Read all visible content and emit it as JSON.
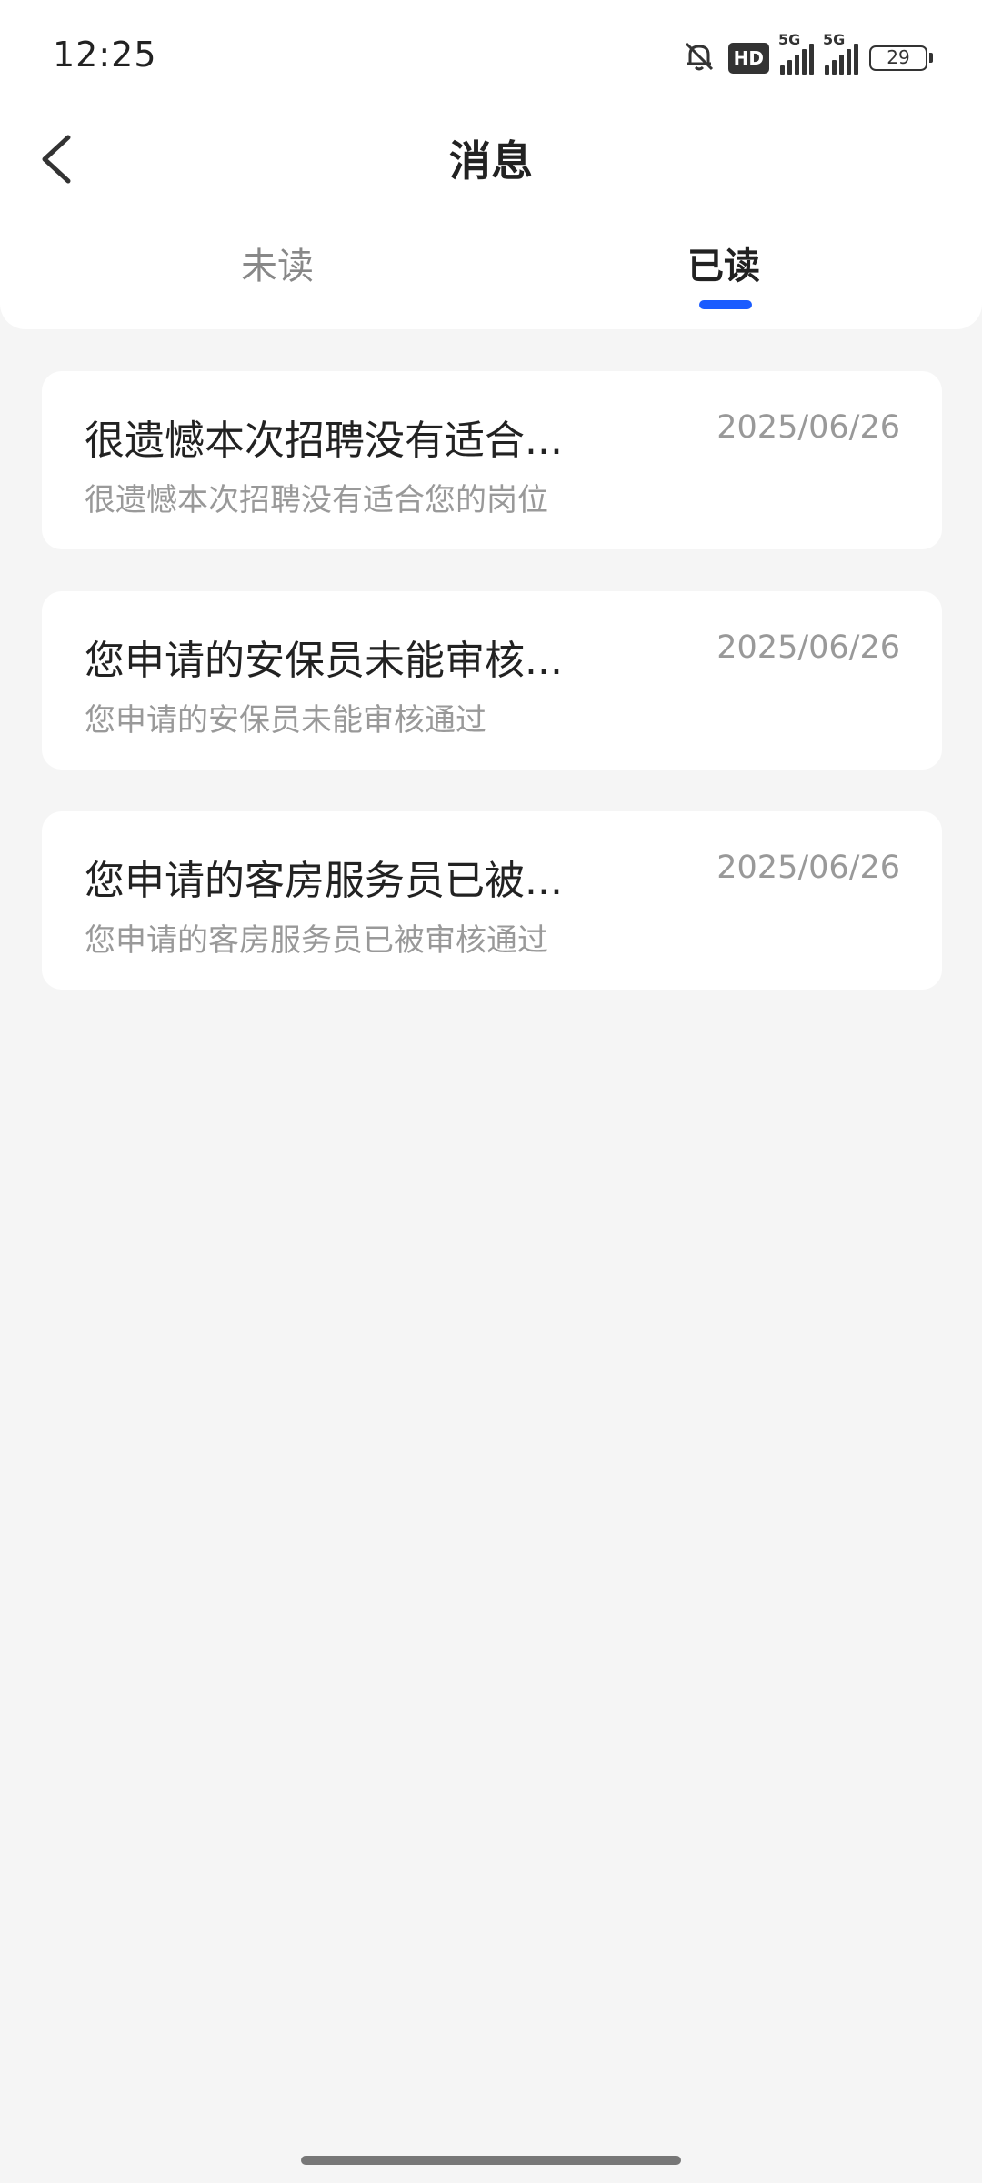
{
  "status_bar": {
    "time": "12:25",
    "icons": [
      "bell-off-icon",
      "hd-voice-icon",
      "signal-5g-icon",
      "signal-5g-icon",
      "battery-icon"
    ],
    "hd_label": "HD",
    "network1": "5G",
    "network2": "5G",
    "battery_level": "29"
  },
  "header": {
    "title": "消息",
    "back_icon": "chevron-left-icon"
  },
  "tabs": [
    {
      "label": "未读",
      "active": false
    },
    {
      "label": "已读",
      "active": true
    }
  ],
  "colors": {
    "accent": "#1a5cff",
    "background": "#f5f5f5",
    "card": "#ffffff",
    "secondary_text": "#999999"
  },
  "messages": [
    {
      "title": "很遗憾本次招聘没有适合...",
      "date": "2025/06/26",
      "summary": "很遗憾本次招聘没有适合您的岗位"
    },
    {
      "title": "您申请的安保员未能审核...",
      "date": "2025/06/26",
      "summary": "您申请的安保员未能审核通过"
    },
    {
      "title": "您申请的客房服务员已被...",
      "date": "2025/06/26",
      "summary": "您申请的客房服务员已被审核通过"
    }
  ]
}
